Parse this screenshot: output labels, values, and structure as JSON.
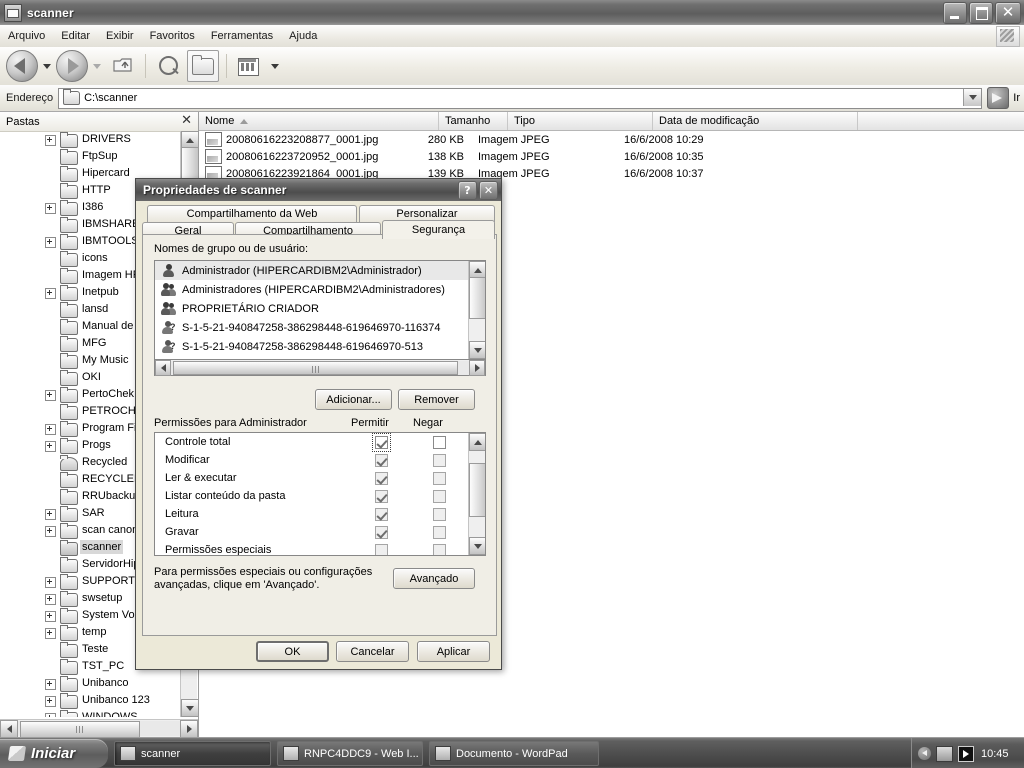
{
  "window": {
    "title": "scanner",
    "icon": "folder-window-icon",
    "buttons": {
      "minimize": "minimize-button",
      "maximize": "maximize-button",
      "close": "close-button"
    }
  },
  "menubar": {
    "items": [
      {
        "label": "Arquivo",
        "accel": "A"
      },
      {
        "label": "Editar",
        "accel": "E"
      },
      {
        "label": "Exibir",
        "accel": "x"
      },
      {
        "label": "Favoritos",
        "accel": "F"
      },
      {
        "label": "Ferramentas",
        "accel": "e"
      },
      {
        "label": "Ajuda",
        "accel": "u"
      }
    ]
  },
  "toolbar": {
    "back": "Voltar",
    "forward": "Avançar",
    "up": "Acima",
    "search": "Pesquisar",
    "folders": "Pastas",
    "views": "Modos de exibição"
  },
  "addressbar": {
    "label": "Endereço",
    "value": "C:\\scanner",
    "placeholder": "C:\\scanner",
    "go_label": "Ir"
  },
  "folders_pane": {
    "header": "Pastas",
    "close_icon": "✕",
    "items": [
      {
        "label": "DRIVERS",
        "expandable": true,
        "icon": "folder-icon"
      },
      {
        "label": "FtpSup",
        "expandable": false,
        "icon": "folder-icon"
      },
      {
        "label": "Hipercard",
        "expandable": false,
        "icon": "folder-icon"
      },
      {
        "label": "HTTP",
        "expandable": false,
        "icon": "folder-icon"
      },
      {
        "label": "I386",
        "expandable": true,
        "icon": "folder-icon"
      },
      {
        "label": "IBMSHARE",
        "expandable": false,
        "icon": "folder-icon"
      },
      {
        "label": "IBMTOOLS",
        "expandable": true,
        "icon": "folder-icon"
      },
      {
        "label": "icons",
        "expandable": false,
        "icon": "folder-icon"
      },
      {
        "label": "Imagem HP",
        "expandable": false,
        "icon": "folder-icon"
      },
      {
        "label": "Inetpub",
        "expandable": true,
        "icon": "folder-icon"
      },
      {
        "label": "lansd",
        "expandable": false,
        "icon": "folder-icon"
      },
      {
        "label": "Manual de",
        "expandable": false,
        "icon": "folder-icon"
      },
      {
        "label": "MFG",
        "expandable": false,
        "icon": "folder-icon"
      },
      {
        "label": "My Music",
        "expandable": false,
        "icon": "folder-icon"
      },
      {
        "label": "OKI",
        "expandable": false,
        "icon": "folder-icon"
      },
      {
        "label": "PertoChek",
        "expandable": true,
        "icon": "folder-icon"
      },
      {
        "label": "PETROCHE",
        "expandable": false,
        "icon": "folder-icon"
      },
      {
        "label": "Program Fi",
        "expandable": true,
        "icon": "folder-icon"
      },
      {
        "label": "Progs",
        "expandable": true,
        "icon": "folder-icon"
      },
      {
        "label": "Recycled",
        "expandable": false,
        "icon": "recycle-bin-icon"
      },
      {
        "label": "RECYCLER",
        "expandable": false,
        "icon": "folder-icon"
      },
      {
        "label": "RRUbackup",
        "expandable": false,
        "icon": "folder-icon"
      },
      {
        "label": "SAR",
        "expandable": true,
        "icon": "folder-icon"
      },
      {
        "label": "scan canon",
        "expandable": true,
        "icon": "folder-icon"
      },
      {
        "label": "scanner",
        "expandable": false,
        "icon": "folder-open-icon",
        "selected": true
      },
      {
        "label": "ServidorHip",
        "expandable": false,
        "icon": "folder-icon"
      },
      {
        "label": "SUPPORT",
        "expandable": true,
        "icon": "folder-icon"
      },
      {
        "label": "swsetup",
        "expandable": true,
        "icon": "folder-icon"
      },
      {
        "label": "System Vol",
        "expandable": true,
        "icon": "folder-icon"
      },
      {
        "label": "temp",
        "expandable": true,
        "icon": "folder-icon"
      },
      {
        "label": "Teste",
        "expandable": false,
        "icon": "folder-icon"
      },
      {
        "label": "TST_PC",
        "expandable": false,
        "icon": "folder-icon"
      },
      {
        "label": "Unibanco",
        "expandable": true,
        "icon": "folder-icon"
      },
      {
        "label": "Unibanco 123",
        "expandable": true,
        "icon": "folder-icon"
      },
      {
        "label": "WINDOWS",
        "expandable": true,
        "icon": "folder-icon"
      }
    ]
  },
  "file_list": {
    "columns": [
      "Nome",
      "Tamanho",
      "Tipo",
      "Data de modificação"
    ],
    "sorted_by": "Nome",
    "sort_direction": "asc",
    "rows": [
      {
        "name": "20080616223208877_0001.jpg",
        "size": "280 KB",
        "type": "Imagem JPEG",
        "modified": "16/6/2008 10:29"
      },
      {
        "name": "20080616223720952_0001.jpg",
        "size": "138 KB",
        "type": "Imagem JPEG",
        "modified": "16/6/2008 10:35"
      },
      {
        "name": "20080616223921864_0001.jpg",
        "size": "139 KB",
        "type": "Imagem JPEG",
        "modified": "16/6/2008 10:37"
      }
    ]
  },
  "dialog": {
    "title": "Propriedades de scanner",
    "help_glyph": "?",
    "close_glyph": "✕",
    "tabs_row1": [
      {
        "label": "Compartilhamento da Web",
        "active": false
      },
      {
        "label": "Personalizar",
        "active": false
      }
    ],
    "tabs_row2": [
      {
        "label": "Geral",
        "active": false
      },
      {
        "label": "Compartilhamento",
        "active": false
      },
      {
        "label": "Segurança",
        "active": true
      }
    ],
    "security": {
      "users_label": "Nomes de grupo ou de usuário:",
      "users_label_accel": "g",
      "users": [
        {
          "name": "Administrador (HIPERCARDIBM2\\Administrador)",
          "icon": "user-icon",
          "selected": true
        },
        {
          "name": "Administradores (HIPERCARDIBM2\\Administradores)",
          "icon": "group-icon",
          "selected": false
        },
        {
          "name": "PROPRIETÁRIO CRIADOR",
          "icon": "group-icon",
          "selected": false
        },
        {
          "name": "S-1-5-21-940847258-386298448-619646970-116374",
          "icon": "unknown-sid-icon",
          "selected": false
        },
        {
          "name": "S-1-5-21-940847258-386298448-619646970-513",
          "icon": "unknown-sid-icon",
          "selected": false
        }
      ],
      "add_button": "Adicionar...",
      "add_button_accel": "d",
      "remove_button": "Remover",
      "remove_button_accel": "R",
      "permissions_label": "Permissões para Administrador",
      "permissions_label_accel": "P",
      "col_allow": "Permitir",
      "col_deny": "Negar",
      "permissions": [
        {
          "name": "Controle total",
          "allow": true,
          "deny": false,
          "focused": true,
          "dim": false
        },
        {
          "name": "Modificar",
          "allow": true,
          "deny": false,
          "focused": false,
          "dim": true
        },
        {
          "name": "Ler & executar",
          "allow": true,
          "deny": false,
          "focused": false,
          "dim": true
        },
        {
          "name": "Listar conteúdo da pasta",
          "allow": true,
          "deny": false,
          "focused": false,
          "dim": true
        },
        {
          "name": "Leitura",
          "allow": true,
          "deny": false,
          "focused": false,
          "dim": true
        },
        {
          "name": "Gravar",
          "allow": true,
          "deny": false,
          "focused": false,
          "dim": true
        },
        {
          "name": "Permissões especiais",
          "allow": false,
          "deny": false,
          "focused": false,
          "dim": true
        }
      ],
      "advanced_text_line1": "Para permissões especiais ou configurações",
      "advanced_text_line2": "avançadas, clique em 'Avançado'.",
      "advanced_button": "Avançado",
      "advanced_button_accel": "v"
    },
    "footer": {
      "ok": "OK",
      "cancel": "Cancelar",
      "apply": "Aplicar",
      "apply_accel": "l"
    }
  },
  "taskbar": {
    "start": "Iniciar",
    "tasks": [
      {
        "label": "scanner",
        "icon": "folder-icon",
        "active": true
      },
      {
        "label": "RNPC4DDC9 - Web I...",
        "icon": "browser-icon",
        "active": false
      },
      {
        "label": "Documento - WordPad",
        "icon": "wordpad-icon",
        "active": false
      }
    ],
    "tray": {
      "show_hidden_icon": "chevron-left-icon",
      "network_icon": "network-icon",
      "media_icon": "media-play-icon",
      "clock": "10:45"
    }
  }
}
